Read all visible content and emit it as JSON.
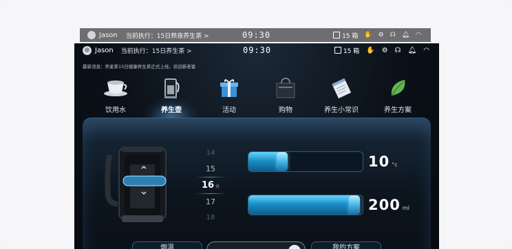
{
  "ghost_header": {
    "user": "Jason",
    "executing": "当前执行：15日熬夜养生茶 >",
    "time": "09:30",
    "box_count": "15 箱"
  },
  "status_bar": {
    "user": "Jason",
    "executing": "当前执行：15日养生茶 >",
    "time": "09:30",
    "box_count": "15 箱"
  },
  "news": "最新消息：荞麦茶15日健康养生茶正式上线，欢迎新老客",
  "menu": {
    "items": [
      {
        "label": "饮用水",
        "icon": "teacup-icon"
      },
      {
        "label": "养生壶",
        "icon": "kettle-icon",
        "active": true
      },
      {
        "label": "活动",
        "icon": "gift-icon"
      },
      {
        "label": "购物",
        "icon": "shopping-bag-icon"
      },
      {
        "label": "养生小常识",
        "icon": "notebook-icon"
      },
      {
        "label": "养生方案",
        "icon": "leaf-icon"
      }
    ]
  },
  "picker": {
    "values": [
      "14",
      "15",
      "16",
      "17",
      "18"
    ],
    "selected": "16",
    "unit": "分"
  },
  "temperature": {
    "value": "10",
    "unit": "°c",
    "fill_fraction": 0.27
  },
  "volume": {
    "value": "200",
    "unit": "ml",
    "fill_fraction": 0.97
  },
  "bottom": {
    "left_label": "烟温",
    "right_label": "我的方案"
  },
  "colors": {
    "accent": "#3fb2e8",
    "background": "#0b1119"
  }
}
